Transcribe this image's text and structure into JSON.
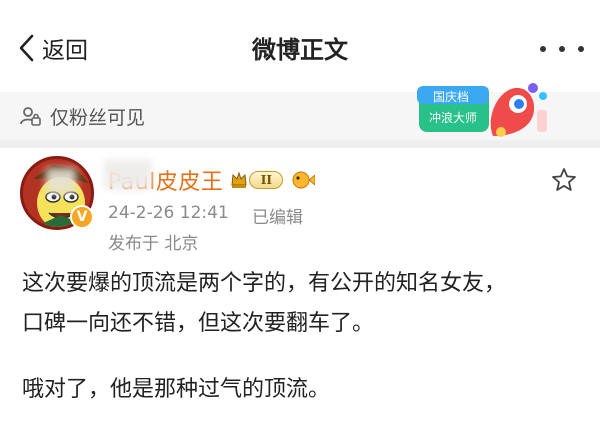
{
  "nav": {
    "back_label": "返回",
    "title": "微博正文",
    "more_icon": "more-dots-icon"
  },
  "visibility": {
    "icon": "lock-people-icon",
    "label": "仅粉丝可见"
  },
  "banner": {
    "line1": "国庆档",
    "line2": "冲浪大师"
  },
  "post": {
    "username": "Paul皮皮王",
    "level": "II",
    "verified_badge": "V",
    "timestamp": "24-2-26 12:41",
    "edited": "已编辑",
    "location": "发布于 北京",
    "line1": "这次要爆的顶流是两个字的，有公开的知名女友，",
    "line2": "口碑一向还不错，但这次要翻车了。",
    "line3": "哦对了，他是那种过气的顶流。"
  },
  "colors": {
    "username": "#e5721a",
    "meta": "#8a8a8a",
    "strip": "#f6f6f6",
    "avatar_ring": "#8a1a12"
  }
}
